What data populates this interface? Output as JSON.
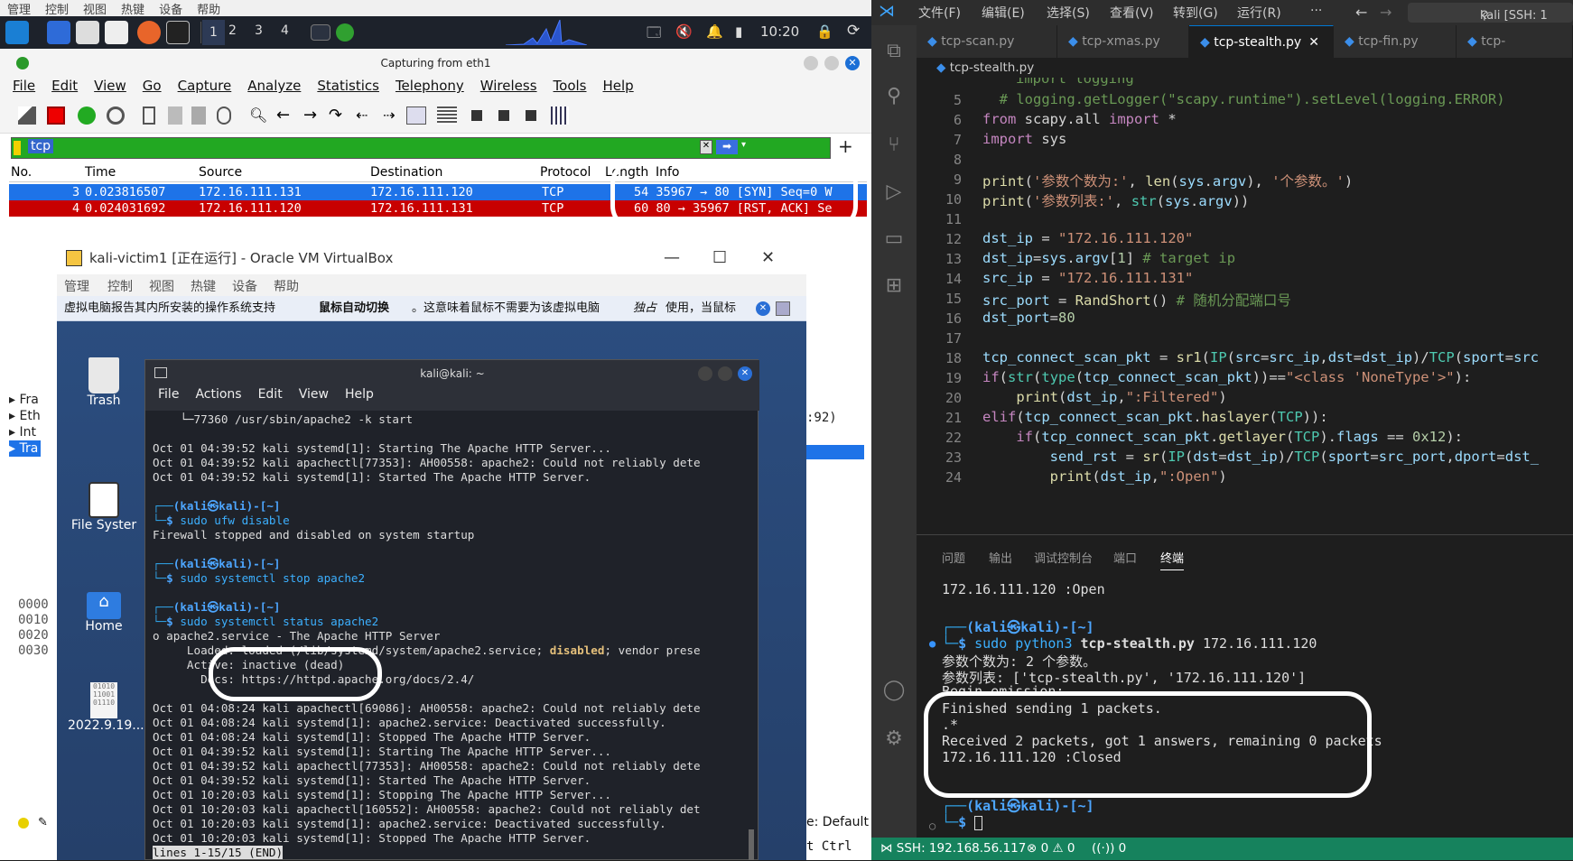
{
  "host_menu": [
    "管理",
    "控制",
    "视图",
    "热键",
    "设备",
    "帮助"
  ],
  "panel": {
    "workspaces": [
      "1",
      "2",
      "3",
      "4"
    ],
    "clock": "10:20"
  },
  "wireshark": {
    "title": "Capturing from eth1",
    "menu": [
      "File",
      "Edit",
      "View",
      "Go",
      "Capture",
      "Analyze",
      "Statistics",
      "Telephony",
      "Wireless",
      "Tools",
      "Help"
    ],
    "filter": "tcp",
    "columns": [
      "No.",
      "Time",
      "Source",
      "Destination",
      "Protocol",
      "Length",
      "Info"
    ],
    "rows": [
      {
        "no": "3",
        "time": "0.023816507",
        "src": "172.16.111.131",
        "dst": "172.16.111.120",
        "proto": "TCP",
        "info": "54 35967 → 80 [SYN] Seq=0 W",
        "color": "#1e73e8"
      },
      {
        "no": "4",
        "time": "0.024031692",
        "src": "172.16.111.120",
        "dst": "172.16.111.131",
        "proto": "TCP",
        "info": "60 80 → 35967 [RST, ACK] Se",
        "color": "#c80000"
      }
    ],
    "detail_rows": [
      "Fra",
      "Eth",
      "Int",
      "Tra"
    ],
    "hex_rows": [
      "0000",
      "0010",
      "0020",
      "0030"
    ],
    "side_text": ":92)",
    "bottom_right": "e: Default",
    "bottom_right2": "t Ctrl"
  },
  "vbox": {
    "title": "kali-victim1 [正在运行] - Oracle VM VirtualBox",
    "menu": [
      "管理",
      "控制",
      "视图",
      "热键",
      "设备",
      "帮助"
    ],
    "note_a": "虚拟电脑报告其内所安装的操作系统支持 ",
    "note_b": "鼠标自动切换",
    "note_c": "。这意味着鼠标不需要为该虚拟电脑",
    "note_d": "独占",
    "note_e": "使用，当鼠标"
  },
  "desktop_icons": [
    "Trash",
    "File Syster",
    "Home",
    "2022.9.19..."
  ],
  "terminal": {
    "title": "kali@kali: ~",
    "menu": [
      "File",
      "Actions",
      "Edit",
      "View",
      "Help"
    ],
    "top_line": "    └─77360 /usr/sbin/apache2 -k start",
    "log1": [
      "Oct 01 04:39:52 kali systemd[1]: Starting The Apache HTTP Server...",
      "Oct 01 04:39:52 kali apachectl[77353]: AH00558: apache2: Could not reliably dete",
      "Oct 01 04:39:52 kali systemd[1]: Started The Apache HTTP Server."
    ],
    "cmd1": "sudo ufw disable",
    "out1": "Firewall stopped and disabled on system startup",
    "cmd2": "sudo systemctl stop apache2",
    "cmd3": "sudo systemctl status apache2",
    "status1": "o apache2.service - The Apache HTTP Server",
    "status2a": "     Loaded: loaded (/lib/systemd/system/apache2.service; ",
    "status2b": "disabled",
    "status2c": "; vendor prese",
    "status3": "     Active: inactive (dead)",
    "status4": "       Docs: https://httpd.apache.org/docs/2.4/",
    "log2": [
      "Oct 01 04:08:24 kali apachectl[69086]: AH00558: apache2: Could not reliably dete",
      "Oct 01 04:08:24 kali systemd[1]: apache2.service: Deactivated successfully.",
      "Oct 01 04:08:24 kali systemd[1]: Stopped The Apache HTTP Server.",
      "Oct 01 04:39:52 kali systemd[1]: Starting The Apache HTTP Server...",
      "Oct 01 04:39:52 kali apachectl[77353]: AH00558: apache2: Could not reliably dete",
      "Oct 01 04:39:52 kali systemd[1]: Started The Apache HTTP Server.",
      "Oct 01 10:20:03 kali systemd[1]: Stopping The Apache HTTP Server...",
      "Oct 01 10:20:03 kali apachectl[160552]: AH00558: apache2: Could not reliably det",
      "Oct 01 10:20:03 kali systemd[1]: apache2.service: Deactivated successfully.",
      "Oct 01 10:20:03 kali systemd[1]: Stopped The Apache HTTP Server."
    ],
    "pager": "lines 1-15/15 (END)",
    "prompt_user": "(kali㉿kali)-[~]"
  },
  "vscode": {
    "menu": [
      "文件(F)",
      "编辑(E)",
      "选择(S)",
      "查看(V)",
      "转到(G)",
      "运行(R)",
      "···"
    ],
    "remote": "kali [SSH: 1",
    "tabs": [
      "tcp-scan.py",
      "tcp-xmas.py",
      "tcp-stealth.py",
      "tcp-fin.py",
      "tcp-"
    ],
    "breadcrumb": "tcp-stealth.py",
    "line_numbers": [
      "5",
      "6",
      "7",
      "8",
      "9",
      "10",
      "11",
      "12",
      "13",
      "14",
      "15",
      "16",
      "17",
      "18",
      "19",
      "20",
      "21",
      "22",
      "23",
      "24"
    ],
    "panel_tabs": [
      "问题",
      "输出",
      "调试控制台",
      "端口",
      "终端"
    ],
    "term_lines": {
      "l0": "172.16.111.120 :Open",
      "prompt": "(kali㉿kali)-[~]",
      "cmd_sudo": "sudo",
      "cmd_py": "python3",
      "cmd_file": "tcp-stealth.py",
      "cmd_arg": "172.16.111.120",
      "o1": "参数个数为: 2 个参数。",
      "o2": "参数列表: ['tcp-stealth.py', '172.16.111.120']",
      "o3": "Begin emission:",
      "o4": "Finished sending 1 packets.",
      "o5": ".*",
      "o6": "Received 2 packets, got 1 answers, remaining 0 packets",
      "o7": "172.16.111.120 :Closed"
    },
    "status": {
      "ssh": "SSH: 192.168.56.117",
      "errors": "0",
      "warnings": "0",
      "ports": "0"
    }
  }
}
